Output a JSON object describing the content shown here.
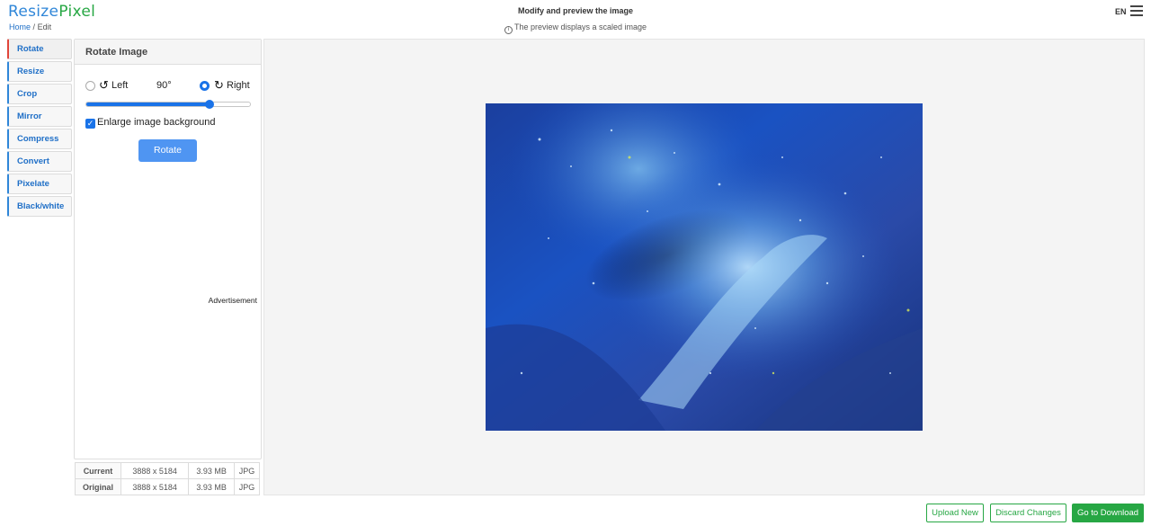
{
  "header": {
    "logo_part1": "Resize",
    "logo_part2": "Pixel",
    "breadcrumb_home": "Home",
    "breadcrumb_sep": "/",
    "breadcrumb_current": "Edit",
    "title": "Modify and preview the image",
    "subtitle": "The preview displays a scaled image",
    "info_icon": "i",
    "language": "EN",
    "menu_icon": "hamburger-menu-icon"
  },
  "sidebar": {
    "items": [
      {
        "label": "Rotate",
        "active": true
      },
      {
        "label": "Resize"
      },
      {
        "label": "Crop"
      },
      {
        "label": "Mirror"
      },
      {
        "label": "Compress"
      },
      {
        "label": "Convert"
      },
      {
        "label": "Pixelate"
      },
      {
        "label": "Black/white"
      }
    ]
  },
  "rotate_panel": {
    "heading": "Rotate Image",
    "left_label": "Left",
    "right_label": "Right",
    "selected_direction": "Right",
    "degrees": "90°",
    "slider_level": 0.75,
    "enlarge_label": "Enlarge image background",
    "enlarge_checked": true,
    "rotate_button": "Rotate",
    "advertisement": "Advertisement",
    "accent_color": "#1a73e8"
  },
  "image_info": {
    "rows": [
      {
        "label": "Current",
        "dimensions": "3888 x 5184",
        "size": "3.93 MB",
        "format": "JPG"
      },
      {
        "label": "Original",
        "dimensions": "3888 x 5184",
        "size": "3.93 MB",
        "format": "JPG"
      }
    ]
  },
  "footer": {
    "upload_new": "Upload New",
    "discard_changes": "Discard Changes",
    "go_to_download": "Go to Download",
    "button_color": "#27a744"
  }
}
